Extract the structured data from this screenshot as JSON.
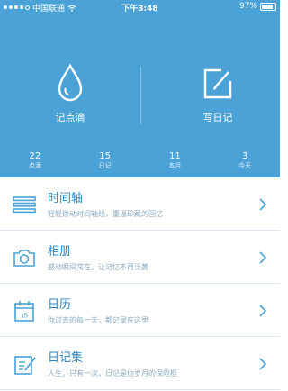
{
  "status_bar": {
    "carrier": "中国联通",
    "time": "下午3:48",
    "battery": "97%"
  },
  "header": {
    "actions": [
      {
        "label": "记点滴",
        "icon": "water-drop-icon"
      },
      {
        "label": "写日记",
        "icon": "edit-square-icon"
      }
    ],
    "stats": [
      {
        "value": "22",
        "label": "点滴"
      },
      {
        "value": "15",
        "label": "日记"
      },
      {
        "value": "11",
        "label": "本月"
      },
      {
        "value": "3",
        "label": "今天"
      }
    ]
  },
  "menu": [
    {
      "title": "时间轴",
      "subtitle": "轻轻拨动时间轴线，重温珍藏的回忆",
      "icon": "timeline-icon"
    },
    {
      "title": "相册",
      "subtitle": "感动瞬间常在，让记忆不再泛黄",
      "icon": "camera-icon"
    },
    {
      "title": "日历",
      "subtitle": "你过去的每一天，都记录在这里",
      "icon": "calendar-icon",
      "icon_text": "15"
    },
    {
      "title": "日记集",
      "subtitle": "人生，只有一次，日记是你岁月的保险柜",
      "icon": "notebook-icon"
    }
  ],
  "colors": {
    "header_bg": "#4aa2d6",
    "accent": "#2d86c3",
    "subtitle": "#8aa9bf"
  }
}
